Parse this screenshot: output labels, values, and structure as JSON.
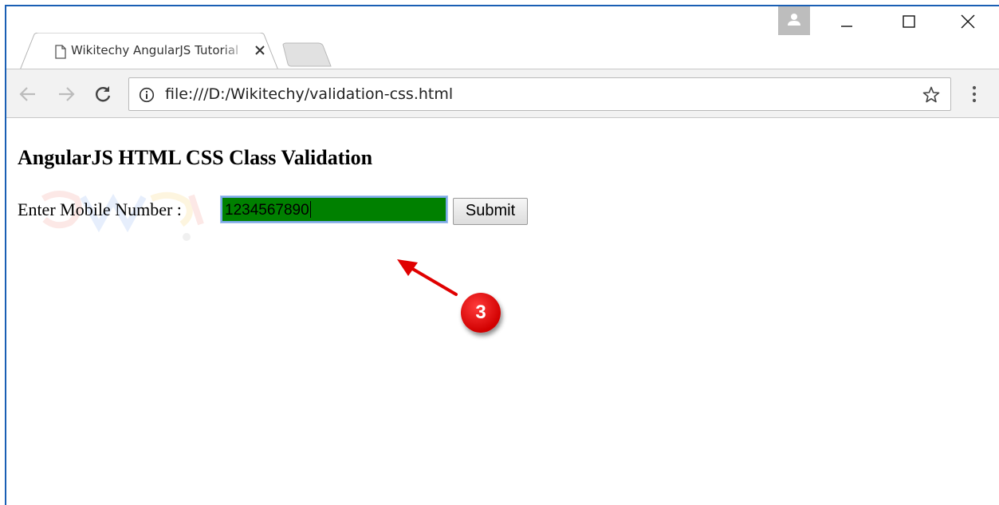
{
  "browser": {
    "tab": {
      "title": "Wikitechy AngularJS Tutorial",
      "close_glyph": "✕",
      "icon": "page-icon"
    },
    "new_tab": {
      "icon": "new-tab-icon"
    },
    "profile": {
      "icon": "person-icon"
    },
    "window_controls": {
      "minimize": "minimize-icon",
      "maximize": "maximize-icon",
      "close": "close-icon"
    },
    "toolbar": {
      "back": "back-arrow-icon",
      "forward": "forward-arrow-icon",
      "reload": "reload-icon",
      "address": {
        "info_icon": "info-icon",
        "url": "file:///D:/Wikitechy/validation-css.html",
        "bookmark_icon": "star-icon"
      },
      "menu": "kebab-menu-icon"
    }
  },
  "page": {
    "heading": "AngularJS HTML CSS Class Validation",
    "form": {
      "label": "Enter Mobile Number :",
      "input_value": "1234567890",
      "input_background": "#008000",
      "submit_label": "Submit"
    },
    "annotation": {
      "step_number": "3",
      "color": "#e00000"
    }
  }
}
